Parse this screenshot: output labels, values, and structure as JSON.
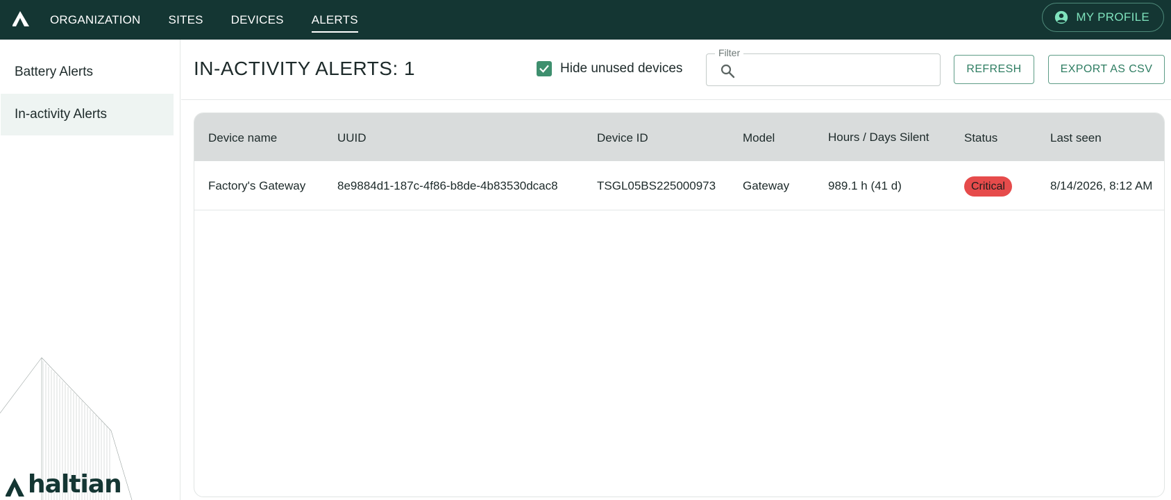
{
  "nav": {
    "items": [
      {
        "label": "ORGANIZATION"
      },
      {
        "label": "SITES"
      },
      {
        "label": "DEVICES"
      },
      {
        "label": "ALERTS"
      }
    ],
    "active": "ALERTS",
    "profile_label": "MY PROFILE"
  },
  "sidebar": {
    "items": [
      {
        "label": "Battery Alerts"
      },
      {
        "label": "In-activity Alerts"
      }
    ],
    "brand": "haltian"
  },
  "header": {
    "title": "IN-ACTIVITY ALERTS: 1",
    "hide_unused_label": "Hide unused devices",
    "hide_unused_checked": true,
    "filter_label": "Filter",
    "filter_value": "",
    "refresh_label": "REFRESH",
    "export_label": "EXPORT AS CSV"
  },
  "table": {
    "columns": [
      "Device name",
      "UUID",
      "Device ID",
      "Model",
      "Hours / Days Silent",
      "Status",
      "Last seen"
    ],
    "rows": [
      {
        "device_name": "Factory's Gateway",
        "uuid": "8e9884d1-187c-4f86-b8de-4b83530dcac8",
        "device_id": "TSGL05BS225000973",
        "model": "Gateway",
        "silent": "989.1 h (41 d)",
        "status": "Critical",
        "last_seen": "8/14/2026, 8:12 AM"
      }
    ]
  },
  "colors": {
    "topbar": "#143633",
    "accent": "#3e8f6e",
    "critical": "#e64b4b"
  }
}
